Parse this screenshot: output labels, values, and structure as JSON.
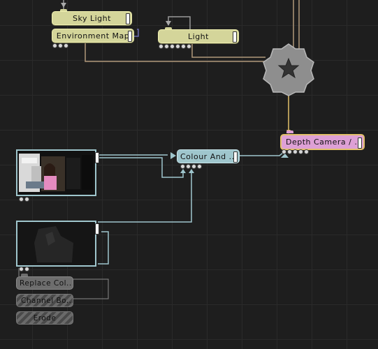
{
  "graph": {
    "nodes": {
      "sky_light": {
        "label": "Sky Light",
        "ports": 3
      },
      "environment_map": {
        "label": "Environment Map",
        "ports": 3
      },
      "light": {
        "label": "Light",
        "ports": 6
      },
      "depth_camera": {
        "label": "Depth Camera / ...",
        "ports": 5
      },
      "colour_and": {
        "label": "Colour And ...",
        "ports": 4
      },
      "replace_col": {
        "label": "Replace Col..."
      },
      "channel_bo": {
        "label": "Channel Bo..."
      },
      "erode": {
        "label": "Erode"
      }
    },
    "thumbnails": {
      "video_feed": {
        "ports": 2
      },
      "depth_feed": {
        "ports": 2
      }
    },
    "colors": {
      "yellow_node": "#d4d59a",
      "pink_node": "#dea0d6",
      "teal_node": "#9fc6cd",
      "wire_teal": "#9fc6cd",
      "wire_tan": "#b0987a",
      "background": "#1e1e1e"
    },
    "icons": {
      "root": "gear-icon"
    }
  }
}
